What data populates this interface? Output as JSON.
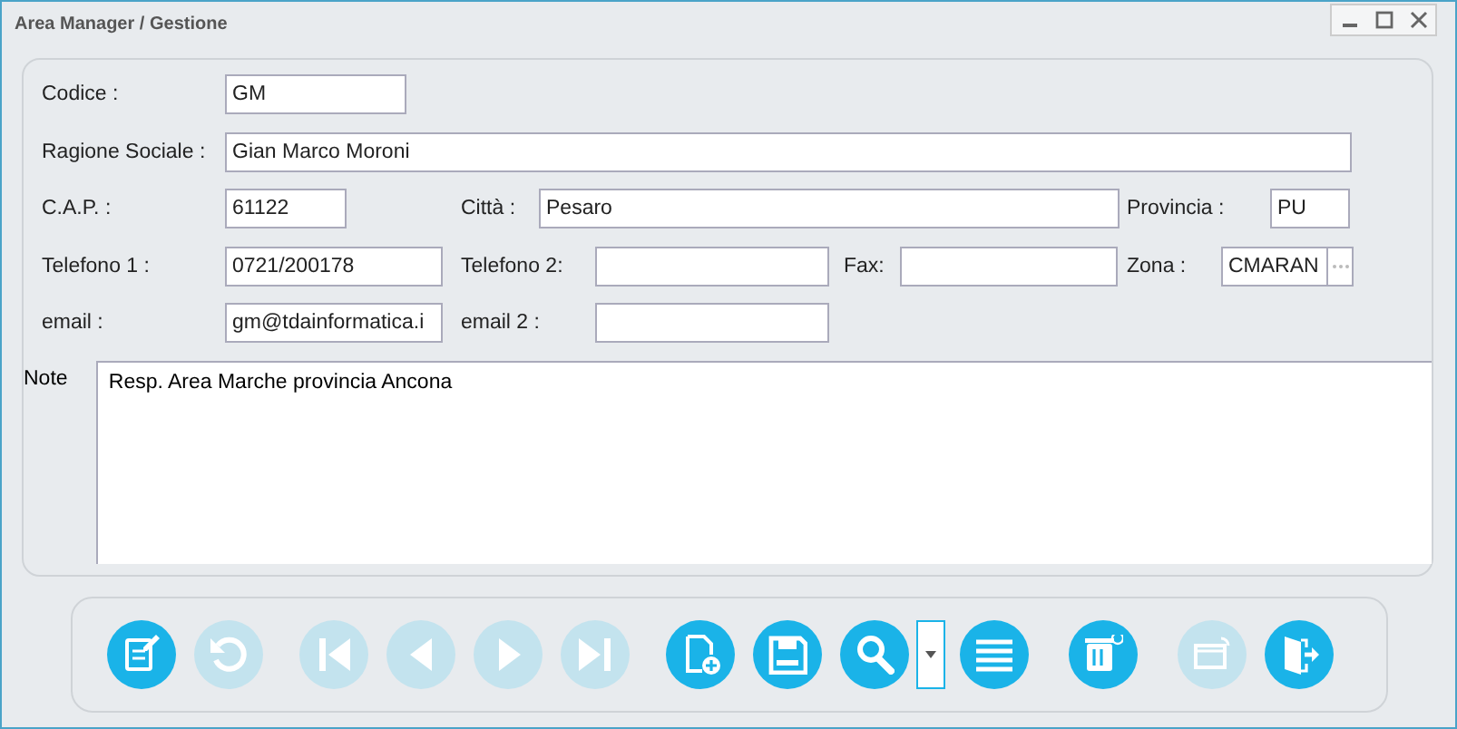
{
  "window": {
    "title": "Area Manager / Gestione"
  },
  "form": {
    "fields": [
      {
        "label": "Codice :",
        "value": "GM"
      },
      {
        "label": "Ragione Sociale :",
        "value": "Gian Marco Moroni"
      },
      {
        "label": "C.A.P. :",
        "value": "61122"
      },
      {
        "label": "Città :",
        "value": "Pesaro"
      },
      {
        "label": "Provincia :",
        "value": "PU"
      },
      {
        "label": "Telefono 1 :",
        "value": "0721/200178"
      },
      {
        "label": "Telefono 2:"
      },
      {
        "label": "Fax:"
      },
      {
        "label": "Zona :",
        "value": "CMARAN",
        "lookup": true
      },
      {
        "label": "email :",
        "value": "gm@tdainformatica.i"
      },
      {
        "label": "email 2 :"
      }
    ],
    "note": {
      "label": "Note",
      "value": "Resp. Area Marche provincia Ancona"
    }
  },
  "toolbar": [
    {
      "kind": "edit",
      "disabled": false
    },
    {
      "kind": "undo",
      "disabled": true
    },
    {
      "kind": "first",
      "disabled": true
    },
    {
      "kind": "prev",
      "disabled": true
    },
    {
      "kind": "next",
      "disabled": true
    },
    {
      "kind": "last",
      "disabled": true
    },
    {
      "kind": "new",
      "disabled": false
    },
    {
      "kind": "save",
      "disabled": false
    },
    {
      "kind": "search",
      "disabled": false
    },
    {
      "kind": "dropdown",
      "disabled": false
    },
    {
      "kind": "list",
      "disabled": false
    },
    {
      "kind": "delete",
      "disabled": false
    },
    {
      "kind": "export",
      "disabled": true
    },
    {
      "kind": "exit",
      "disabled": false
    }
  ]
}
